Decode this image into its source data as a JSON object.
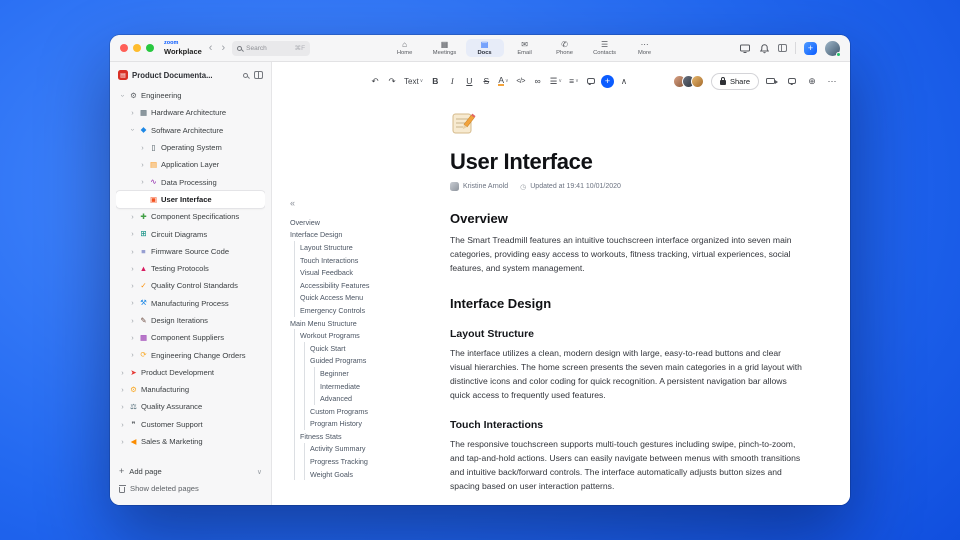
{
  "colors": {
    "accent_blue": "#0b5cff",
    "traffic_red": "#ff5f57",
    "traffic_yellow": "#febc2e",
    "traffic_green": "#28c840",
    "sidebar_bg": "#f7f7f8",
    "presence_green": "#23c16b"
  },
  "icons": {
    "back": "‹",
    "forward": "›",
    "chevron_right": "›",
    "chevron_small": "∨",
    "outline_collapse": "«",
    "clock": "◷",
    "add": "+",
    "more": "⋯"
  },
  "titlebar": {
    "brand_top": "zoom",
    "brand_bottom": "Workplace",
    "search": {
      "value": "Search",
      "shortcut": "⌘F"
    },
    "tabs": [
      {
        "label": "Home",
        "icon": "home",
        "glyph": "⌂",
        "active": false
      },
      {
        "label": "Meetings",
        "icon": "calendar",
        "glyph": "▦",
        "active": false
      },
      {
        "label": "Docs",
        "icon": "document",
        "glyph": "▤",
        "active": true
      },
      {
        "label": "Email",
        "icon": "mail",
        "glyph": "✉",
        "active": false
      },
      {
        "label": "Phone",
        "icon": "phone",
        "glyph": "✆",
        "active": false
      },
      {
        "label": "Contacts",
        "icon": "contacts",
        "glyph": "☰",
        "active": false
      },
      {
        "label": "More",
        "icon": "more",
        "glyph": "⋯",
        "active": false
      }
    ]
  },
  "sidebar": {
    "title": "Product Documenta...",
    "add_page": "Add page",
    "show_deleted": "Show deleted pages",
    "tree": [
      {
        "label": "Engineering",
        "level": 0,
        "chevron": "down",
        "icon": "gear-icon",
        "glyph": "⚙",
        "color": "#5f6368",
        "selected": false
      },
      {
        "label": "Hardware Architecture",
        "level": 1,
        "chevron": "right",
        "icon": "chip-icon",
        "glyph": "▦",
        "color": "#455a64",
        "selected": false
      },
      {
        "label": "Software Architecture",
        "level": 1,
        "chevron": "down",
        "icon": "software-icon",
        "glyph": "◆",
        "color": "#1e88e5",
        "selected": false
      },
      {
        "label": "Operating System",
        "level": 2,
        "chevron": "right",
        "icon": "os-icon",
        "glyph": "▯",
        "color": "#37474f",
        "selected": false
      },
      {
        "label": "Application Layer",
        "level": 2,
        "chevron": "right",
        "icon": "layers-icon",
        "glyph": "▤",
        "color": "#fb8c00",
        "selected": false
      },
      {
        "label": "Data Processing",
        "level": 2,
        "chevron": "right",
        "icon": "waveform-icon",
        "glyph": "∿",
        "color": "#8e24aa",
        "selected": false
      },
      {
        "label": "User Interface",
        "level": 2,
        "chevron": "none",
        "icon": "ui-icon",
        "glyph": "▣",
        "color": "#f4511e",
        "selected": true
      },
      {
        "label": "Component Specifications",
        "level": 1,
        "chevron": "right",
        "icon": "component-icon",
        "glyph": "✚",
        "color": "#43a047",
        "selected": false
      },
      {
        "label": "Circuit Diagrams",
        "level": 1,
        "chevron": "right",
        "icon": "circuit-icon",
        "glyph": "⊞",
        "color": "#00897b",
        "selected": false
      },
      {
        "label": "Firmware Source Code",
        "level": 1,
        "chevron": "right",
        "icon": "code-icon",
        "glyph": "≡",
        "color": "#3949ab",
        "selected": false
      },
      {
        "label": "Testing Protocols",
        "level": 1,
        "chevron": "right",
        "icon": "flask-icon",
        "glyph": "▲",
        "color": "#d81b60",
        "selected": false
      },
      {
        "label": "Quality Control Standards",
        "level": 1,
        "chevron": "right",
        "icon": "check-icon",
        "glyph": "✓",
        "color": "#fb8c00",
        "selected": false
      },
      {
        "label": "Manufacturing Process",
        "level": 1,
        "chevron": "right",
        "icon": "hammer-icon",
        "glyph": "⚒",
        "color": "#1e88e5",
        "selected": false
      },
      {
        "label": "Design Iterations",
        "level": 1,
        "chevron": "right",
        "icon": "pencil-icon",
        "glyph": "✎",
        "color": "#6d4c41",
        "selected": false
      },
      {
        "label": "Component Suppliers",
        "level": 1,
        "chevron": "right",
        "icon": "grid-icon",
        "glyph": "▦",
        "color": "#8e24aa",
        "selected": false
      },
      {
        "label": "Engineering Change Orders",
        "level": 1,
        "chevron": "right",
        "icon": "refresh-icon",
        "glyph": "⟳",
        "color": "#f9a825",
        "selected": false
      },
      {
        "label": "Product Development",
        "level": 0,
        "chevron": "right",
        "icon": "rocket-icon",
        "glyph": "➤",
        "color": "#e53935",
        "selected": false
      },
      {
        "label": "Manufacturing",
        "level": 0,
        "chevron": "right",
        "icon": "factory-icon",
        "glyph": "⚙",
        "color": "#f9a825",
        "selected": false
      },
      {
        "label": "Quality Assurance",
        "level": 0,
        "chevron": "right",
        "icon": "scale-icon",
        "glyph": "⚖",
        "color": "#546e7a",
        "selected": false
      },
      {
        "label": "Customer Support",
        "level": 0,
        "chevron": "right",
        "icon": "chat-icon",
        "glyph": "❞",
        "color": "#5f6368",
        "selected": false
      },
      {
        "label": "Sales & Marketing",
        "level": 0,
        "chevron": "right",
        "icon": "megaphone-icon",
        "glyph": "◀",
        "color": "#fb8c00",
        "selected": false
      }
    ]
  },
  "outline": {
    "items": [
      {
        "label": "Overview",
        "level": 0
      },
      {
        "label": "Interface Design",
        "level": 0
      },
      {
        "label": "Layout Structure",
        "level": 1
      },
      {
        "label": "Touch Interactions",
        "level": 1
      },
      {
        "label": "Visual Feedback",
        "level": 1
      },
      {
        "label": "Accessibility Features",
        "level": 1
      },
      {
        "label": "Quick Access Menu",
        "level": 1
      },
      {
        "label": "Emergency Controls",
        "level": 1
      },
      {
        "label": "Main Menu Structure",
        "level": 0
      },
      {
        "label": "Workout Programs",
        "level": 1
      },
      {
        "label": "Quick Start",
        "level": 2
      },
      {
        "label": "Guided Programs",
        "level": 2
      },
      {
        "label": "Beginner",
        "level": 3
      },
      {
        "label": "Intermediate",
        "level": 3
      },
      {
        "label": "Advanced",
        "level": 3
      },
      {
        "label": "Custom Programs",
        "level": 2
      },
      {
        "label": "Program History",
        "level": 2
      },
      {
        "label": "Fitness Stats",
        "level": 1
      },
      {
        "label": "Activity Summary",
        "level": 2
      },
      {
        "label": "Progress Tracking",
        "level": 2
      },
      {
        "label": "Weight Goals",
        "level": 2
      }
    ]
  },
  "toolbar": {
    "share_label": "Share",
    "items": [
      {
        "name": "undo-button",
        "glyph": "↶"
      },
      {
        "name": "redo-button",
        "glyph": "↷"
      },
      {
        "name": "text-style-select",
        "label": "Text",
        "chevron": true
      },
      {
        "name": "bold-button",
        "glyph": "B",
        "cls": "fmt-b"
      },
      {
        "name": "italic-button",
        "glyph": "I",
        "cls": "fmt-i"
      },
      {
        "name": "underline-button",
        "glyph": "U",
        "cls": "fmt-u"
      },
      {
        "name": "strikethrough-button",
        "glyph": "S",
        "cls": "fmt-s"
      },
      {
        "name": "text-color-button",
        "glyph": "A",
        "chevron": true,
        "cls": "fmt-color"
      },
      {
        "name": "inline-code-button",
        "glyph": "</>",
        "cls": "fmt-code"
      },
      {
        "name": "link-button",
        "glyph": "∞"
      },
      {
        "name": "list-button",
        "glyph": "☰",
        "chevron": true
      },
      {
        "name": "align-button",
        "glyph": "≡",
        "chevron": true
      },
      {
        "name": "comment-button",
        "kind": "bubble"
      },
      {
        "name": "insert-button",
        "glyph": "+",
        "cls": "insert-plus"
      },
      {
        "name": "collapse-toolbar-button",
        "glyph": "∧"
      }
    ],
    "collaborators": [
      {
        "color1": "#d9a184",
        "color2": "#8a5a3b"
      },
      {
        "color1": "#6b7280",
        "color2": "#2f3640"
      },
      {
        "color1": "#e7b86e",
        "color2": "#a46a2c"
      }
    ],
    "actions": [
      {
        "name": "video-button",
        "kind": "camera"
      },
      {
        "name": "chat-button",
        "kind": "bubble"
      },
      {
        "name": "globe-button",
        "glyph": "⊕"
      },
      {
        "name": "more-button",
        "glyph": "⋯"
      }
    ]
  },
  "doc": {
    "title": "User Interface",
    "author": "Kristine Arnold",
    "updated": "Updated at 19:41 10/01/2020",
    "sections": {
      "overview_h": "Overview",
      "overview_p": "The Smart Treadmill features an intuitive touchscreen interface organized into seven main categories, providing easy access to workouts, fitness tracking, virtual experiences, social features, and system management.",
      "interface_design_h": "Interface Design",
      "layout_h": "Layout Structure",
      "layout_p": "The interface utilizes a clean, modern design with large, easy-to-read buttons and clear visual hierarchies. The home screen presents the seven main categories in a grid layout with distinctive icons and color coding for quick recognition. A persistent navigation bar allows quick access to frequently used features.",
      "touch_h": "Touch Interactions",
      "touch_p": "The responsive touchscreen supports multi-touch gestures including swipe, pinch-to-zoom, and tap-and-hold actions. Users can easily navigate between menus with smooth transitions and intuitive back/forward controls. The interface automatically adjusts button sizes and spacing based on user interaction patterns."
    }
  }
}
